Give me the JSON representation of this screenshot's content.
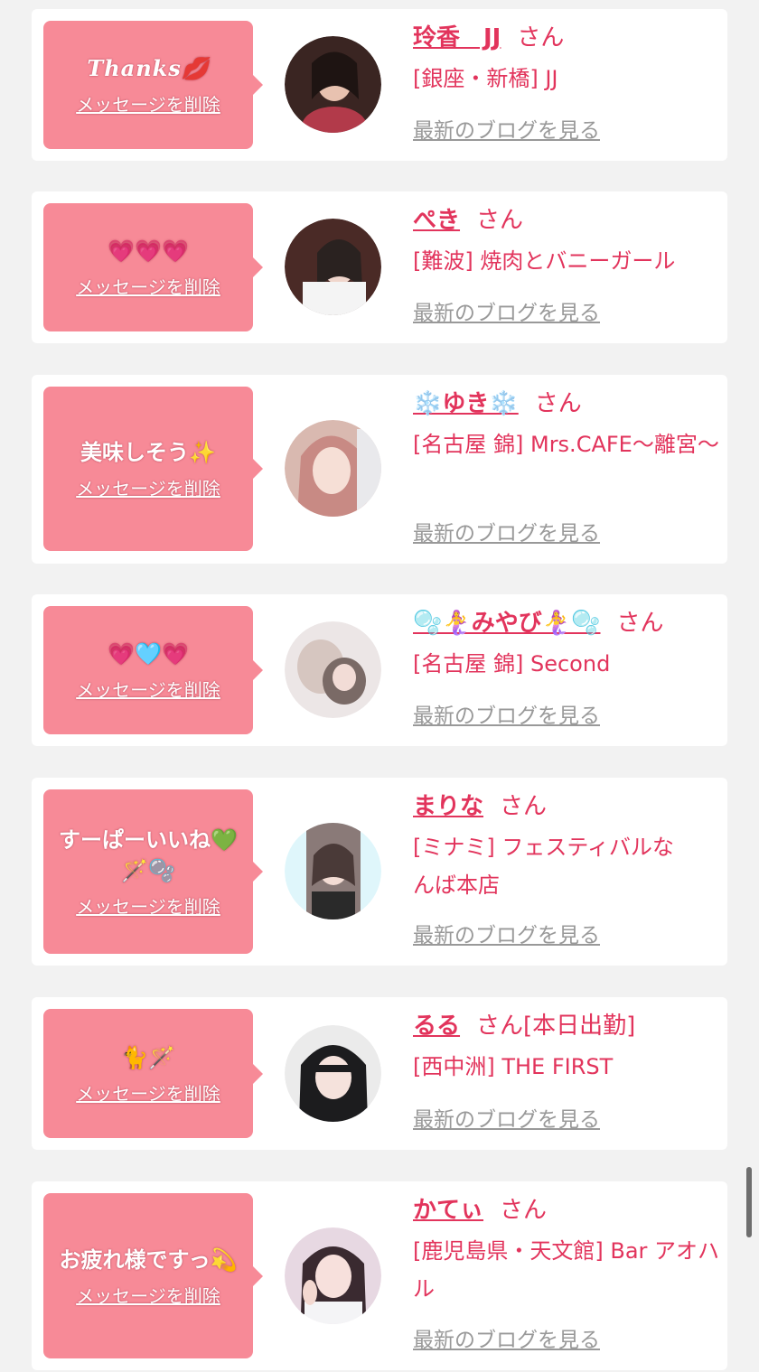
{
  "delete_label": "メッセージを削除",
  "blog_label": "最新のブログを見る",
  "honorific": "さん",
  "colors": {
    "accent": "#e2345c",
    "bubble": "#f78a97",
    "background": "#f2f2f2",
    "link_gray": "#999999"
  },
  "cards": [
    {
      "message": "Thanks💋",
      "name": "玲香　JJ",
      "suffix": "",
      "shop": "[銀座・新橋] JJ"
    },
    {
      "message": "💗💗💗",
      "name": "ぺき",
      "suffix": "",
      "shop": "[難波] 焼肉とバニーガール"
    },
    {
      "message": "美味しそう✨",
      "name": "❄️ゆき❄️",
      "suffix": "",
      "shop": "[名古屋 錦] Mrs.CAFE〜離宮〜"
    },
    {
      "message": "💗🩵💗",
      "name": "🫧🧜‍♀️みやび🧜‍♀️🫧",
      "suffix": "",
      "shop": "[名古屋 錦] Second"
    },
    {
      "message": "すーぱーいいね💚🪄🫧",
      "name": "まりな",
      "suffix": "",
      "shop": "[ミナミ] フェスティバルなんば本店"
    },
    {
      "message": "🐈🪄",
      "name": "るる",
      "suffix": "[本日出勤]",
      "shop": "[西中洲] THE FIRST"
    },
    {
      "message": "お疲れ様ですっ💫",
      "name": "かてぃ",
      "suffix": "",
      "shop": "[鹿児島県・天文館] Bar アオハル"
    }
  ]
}
